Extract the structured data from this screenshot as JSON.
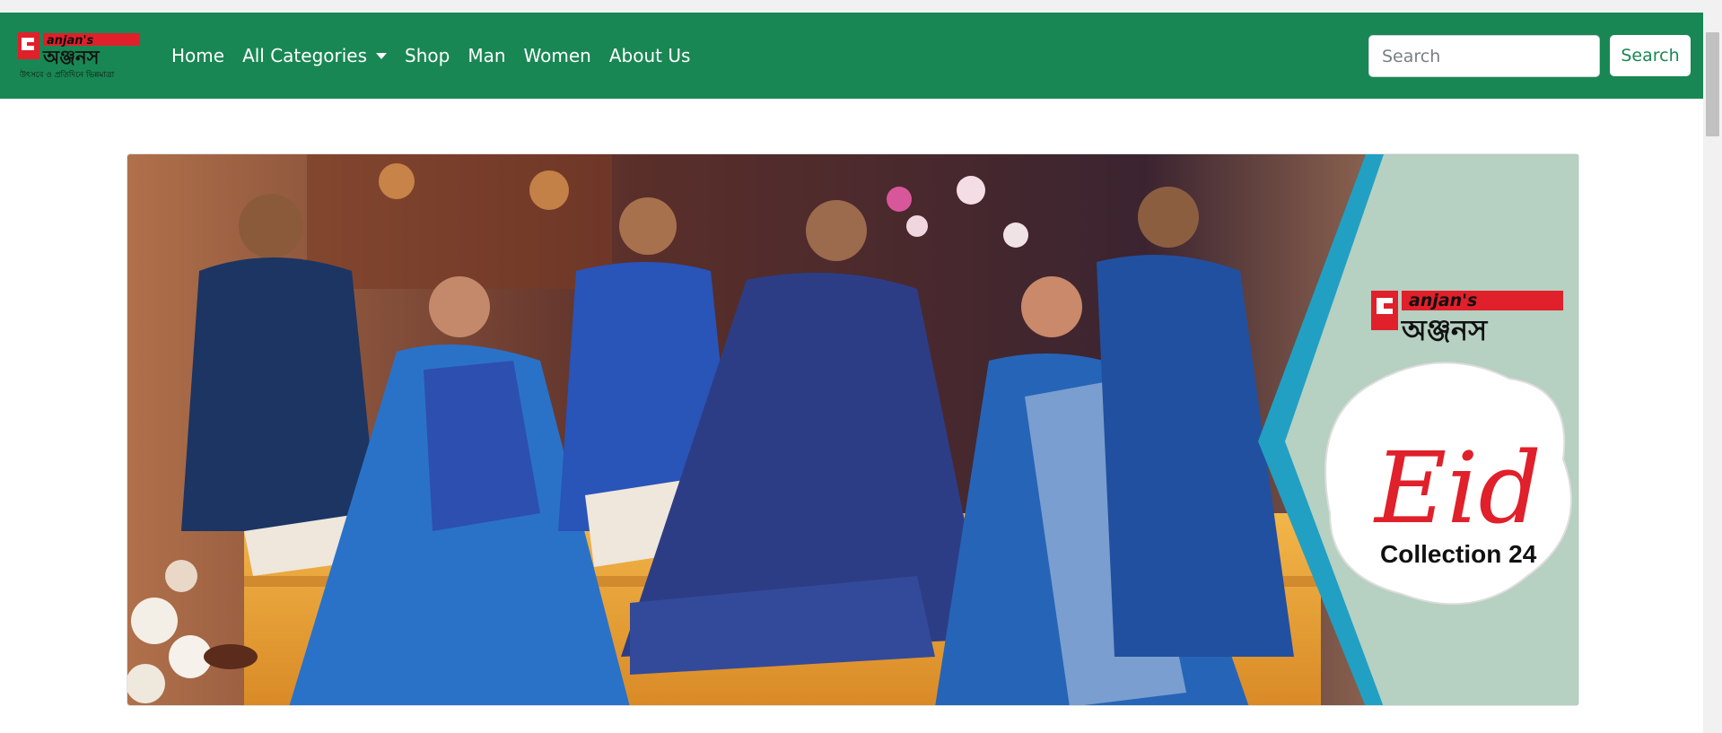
{
  "brand": {
    "logo_text": "anjan's",
    "logo_text_bangla": "অঞ্জনস",
    "tagline": "উৎসবে ও প্রতিদিনে ভিন্নমাত্রা"
  },
  "nav": {
    "items": [
      "Home",
      "All Categories",
      "Shop",
      "Man",
      "Women",
      "About Us"
    ]
  },
  "search": {
    "placeholder": "Search",
    "button_label": "Search"
  },
  "banner": {
    "logo_text": "anjan's",
    "logo_text_bangla": "অঞ্জনস",
    "badge_script": "Eid",
    "badge_subtitle": "Collection 24"
  },
  "colors": {
    "navbar": "#198754",
    "badge_panel": "#b6d0c1",
    "badge_stripe": "#21a0c4",
    "brand_red": "#e0202a"
  }
}
